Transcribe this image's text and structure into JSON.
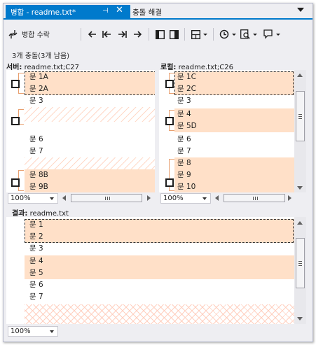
{
  "tabs": {
    "active_label": "병합 - readme.txt*",
    "pin_glyph": "⊣",
    "close_glyph": "✕",
    "second_label": "충돌 해결"
  },
  "toolbar": {
    "accept_merge_label": "병합 수락",
    "icons": [
      "accept-merge-icon",
      "prev-change-icon",
      "first-conflict-icon",
      "last-conflict-icon",
      "next-change-icon",
      "vertical-layout-icon",
      "horizontal-layout-icon",
      "layout-menu-icon",
      "history-icon",
      "compare-icon",
      "comment-icon"
    ]
  },
  "status": {
    "conflict_count": "3개 충돌(3개 남음)"
  },
  "server_pane": {
    "title_bold": "서버:",
    "title_rest": " readme.txt;C27",
    "lines": [
      "문 1A",
      "문 2A",
      "문 3",
      "",
      "",
      "문 6",
      "문 7",
      "",
      "문 8B",
      "문 9B"
    ],
    "zoom": "100%"
  },
  "local_pane": {
    "title_bold": "로컬:",
    "title_rest": " readme.txt;C26",
    "lines": [
      "문 1C",
      "문 2C",
      "문 3",
      "문 4",
      "문 5D",
      "문 6",
      "문 7",
      "문 8",
      "문 9",
      "문 10"
    ],
    "zoom": "100%"
  },
  "result_pane": {
    "title_bold": "결과:",
    "title_rest": " readme.txt",
    "lines": [
      "문 1",
      "문 2",
      "문 3",
      "문 4",
      "문 5",
      "문 6",
      "문 7"
    ],
    "zoom": "100%"
  },
  "colors": {
    "accent": "#007acc",
    "conflict_fill": "#ffe0c8",
    "hatch": "#ffd9c8"
  }
}
